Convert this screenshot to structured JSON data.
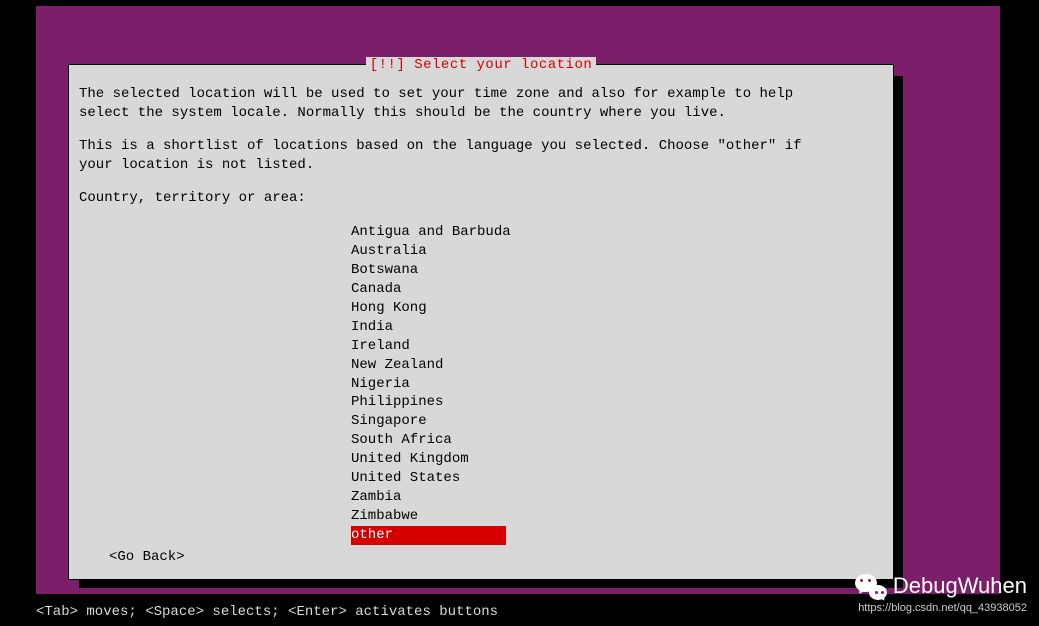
{
  "dialog": {
    "title": "[!!] Select your location",
    "para1": "The selected location will be used to set your time zone and also for example to help\nselect the system locale. Normally this should be the country where you live.",
    "para2": "This is a shortlist of locations based on the language you selected. Choose \"other\" if\nyour location is not listed.",
    "prompt": "Country, territory or area:",
    "items": [
      "Antigua and Barbuda",
      "Australia",
      "Botswana",
      "Canada",
      "Hong Kong",
      "India",
      "Ireland",
      "New Zealand",
      "Nigeria",
      "Philippines",
      "Singapore",
      "South Africa",
      "United Kingdom",
      "United States",
      "Zambia",
      "Zimbabwe",
      "other"
    ],
    "selected_index": 16,
    "goback": "<Go Back>"
  },
  "hint": "<Tab> moves; <Space> selects; <Enter> activates buttons",
  "watermark": {
    "name": "DebugWuhen",
    "url": "https://blog.csdn.net/qq_43938052"
  }
}
